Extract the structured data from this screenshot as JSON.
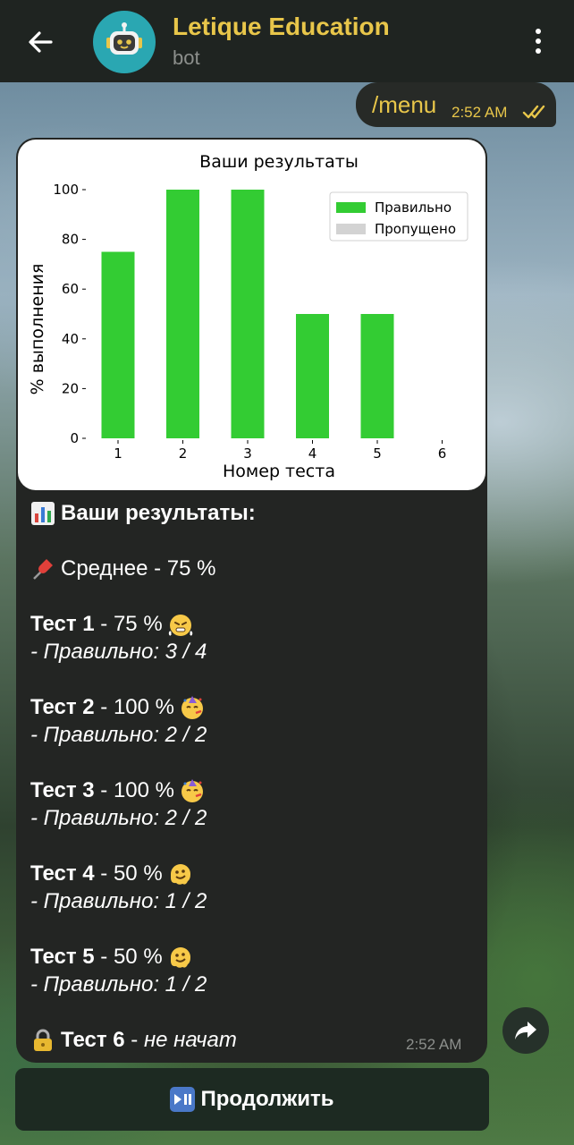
{
  "header": {
    "title": "Letique Education",
    "subtitle": "bot",
    "back_icon": "arrow-left-icon",
    "avatar_icon": "robot-icon",
    "menu_icon": "more-vertical-icon"
  },
  "outgoing": {
    "text": "/menu",
    "time": "2:52 AM",
    "status_icon": "double-check-icon"
  },
  "incoming": {
    "time": "2:52 AM",
    "lines": [
      {
        "icon": "bar-chart-emoji",
        "bold": "Ваши результаты:"
      },
      {
        "icon": "pushpin-emoji",
        "text": "Среднее - 75 %"
      },
      {
        "bold": "Тест 1",
        "text": " - 75 %",
        "icon_after": "steam-face-emoji",
        "detail": "- Правильно: 3 / 4"
      },
      {
        "bold": "Тест 2",
        "text": " - 100 %",
        "icon_after": "party-face-emoji",
        "detail": "- Правильно: 2 / 2"
      },
      {
        "bold": "Тест 3",
        "text": " - 100 %",
        "icon_after": "party-face-emoji",
        "detail": "- Правильно: 2 / 2"
      },
      {
        "bold": "Тест 4",
        "text": " - 50 %",
        "icon_after": "melting-face-emoji",
        "detail": "- Правильно: 1 / 2"
      },
      {
        "bold": "Тест 5",
        "text": " - 50 %",
        "icon_after": "melting-face-emoji",
        "detail": "- Правильно: 1 / 2"
      },
      {
        "icon": "lock-emoji",
        "bold": "Тест 6",
        "italic_tail": "не начат",
        "sep": " - "
      }
    ]
  },
  "chart_data": {
    "type": "bar",
    "title": "Ваши результаты",
    "xlabel": "Номер теста",
    "ylabel": "% выполнения",
    "categories": [
      "1",
      "2",
      "3",
      "4",
      "5",
      "6"
    ],
    "series": [
      {
        "name": "Правильно",
        "values": [
          75,
          100,
          100,
          50,
          50,
          0
        ],
        "color": "#33cc33"
      },
      {
        "name": "Пропущено",
        "values": [
          0,
          0,
          0,
          0,
          0,
          0
        ],
        "color": "#d3d3d3"
      }
    ],
    "yticks": [
      "0",
      "20",
      "40",
      "60",
      "80",
      "100"
    ],
    "ylim": [
      0,
      100
    ],
    "legend": "top-right",
    "grid": false
  },
  "share_icon": "forward-arrow-icon",
  "keyboard": {
    "icon": "play-pause-emoji",
    "label": "Продолжить"
  }
}
